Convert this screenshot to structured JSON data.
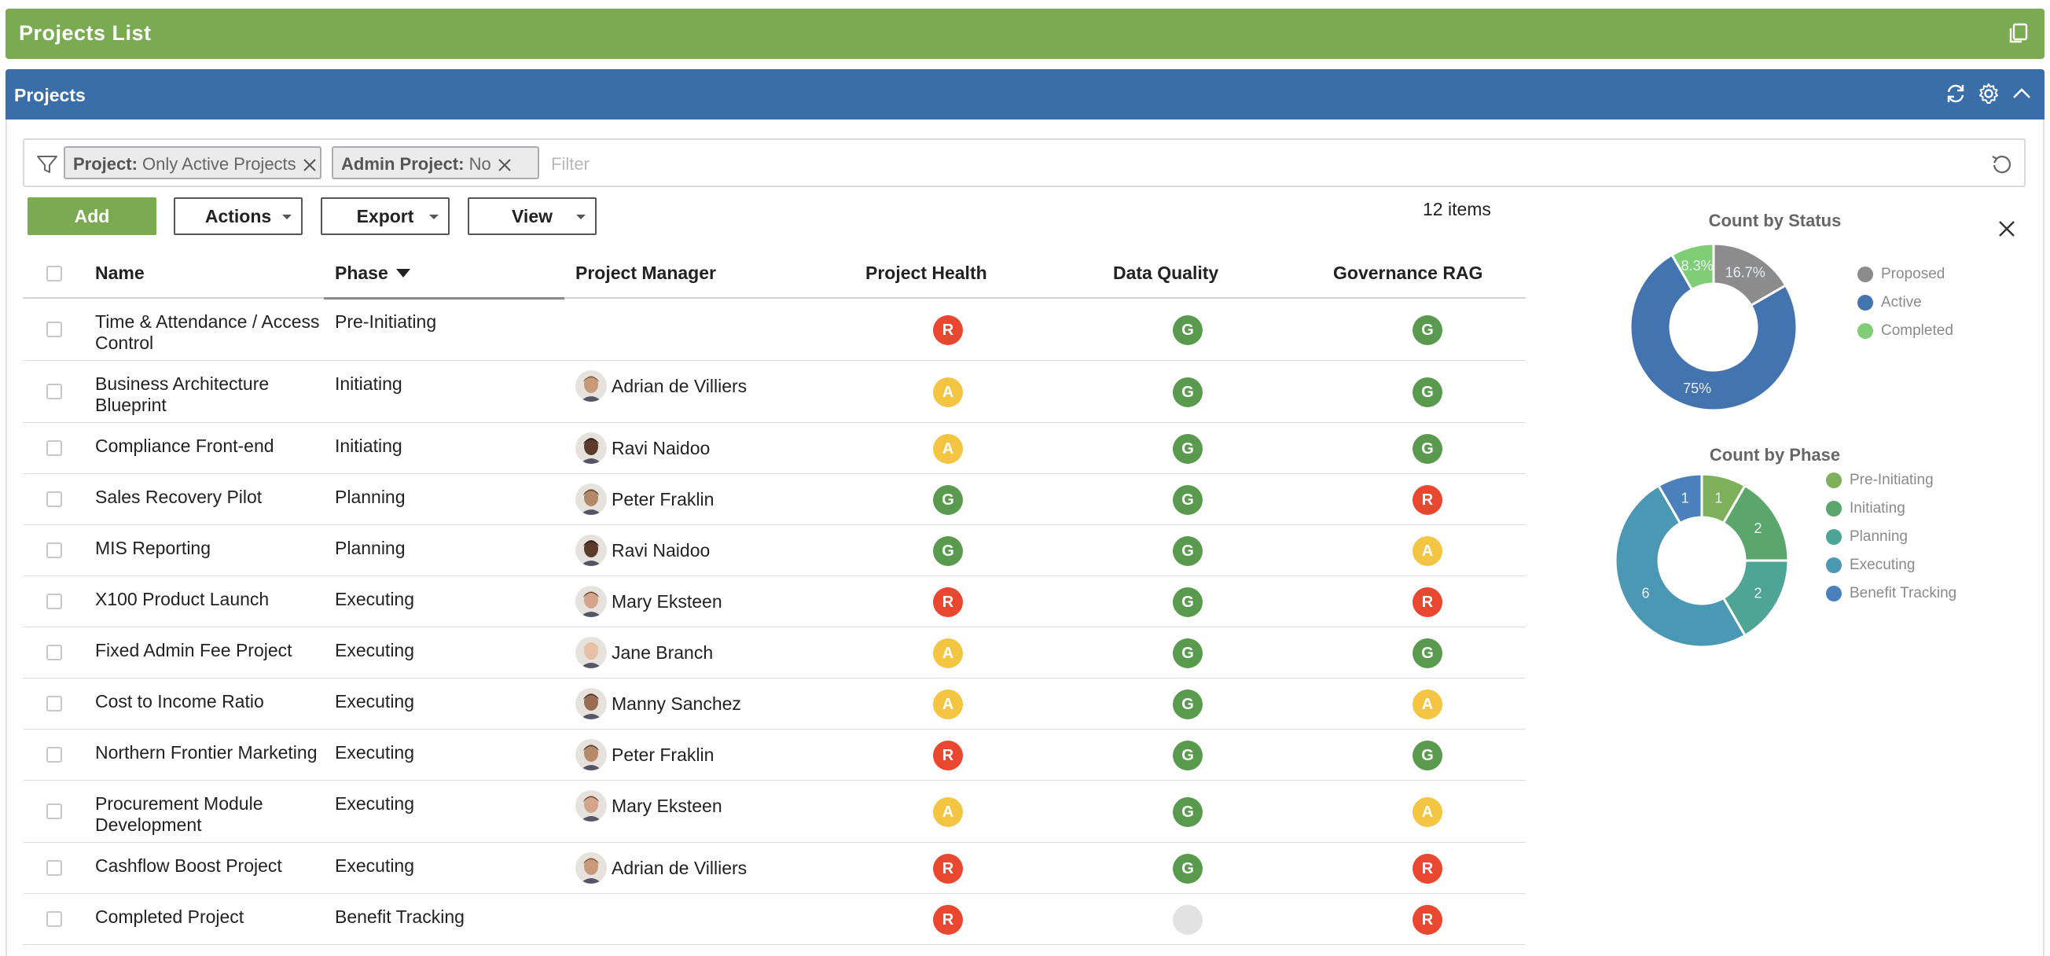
{
  "title_bar": {
    "title": "Projects List",
    "copy_icon": "copy-icon"
  },
  "panel": {
    "title": "Projects",
    "icons": [
      "refresh-icon",
      "gear-icon",
      "chevron-up-icon"
    ]
  },
  "filter": {
    "chips": [
      {
        "key": "Project:",
        "value": " Only Active Projects"
      },
      {
        "key": "Admin Project:",
        "value": " No"
      }
    ],
    "placeholder": "Filter"
  },
  "toolbar": {
    "add": "Add",
    "actions": "Actions",
    "export": "Export",
    "view": "View",
    "item_count": "12 items"
  },
  "table": {
    "columns": [
      "Name",
      "Phase",
      "Project Manager",
      "Project Health",
      "Data Quality",
      "Governance RAG"
    ],
    "rows": [
      {
        "name": "Time & Attendance / Access Control",
        "phase": "Pre-Initiating",
        "manager": "",
        "health": "R",
        "quality": "G",
        "governance": "G"
      },
      {
        "name": "Business Architecture Blueprint",
        "phase": "Initiating",
        "manager": "Adrian de Villiers",
        "health": "A",
        "quality": "G",
        "governance": "G"
      },
      {
        "name": "Compliance Front-end",
        "phase": "Initiating",
        "manager": "Ravi Naidoo",
        "health": "A",
        "quality": "G",
        "governance": "G"
      },
      {
        "name": "Sales Recovery Pilot",
        "phase": "Planning",
        "manager": "Peter Fraklin",
        "health": "G",
        "quality": "G",
        "governance": "R"
      },
      {
        "name": "MIS Reporting",
        "phase": "Planning",
        "manager": "Ravi Naidoo",
        "health": "G",
        "quality": "G",
        "governance": "A"
      },
      {
        "name": "X100 Product Launch",
        "phase": "Executing",
        "manager": "Mary Eksteen",
        "health": "R",
        "quality": "G",
        "governance": "R"
      },
      {
        "name": "Fixed Admin Fee Project",
        "phase": "Executing",
        "manager": "Jane Branch",
        "health": "A",
        "quality": "G",
        "governance": "G"
      },
      {
        "name": "Cost to Income Ratio",
        "phase": "Executing",
        "manager": "Manny Sanchez",
        "health": "A",
        "quality": "G",
        "governance": "A"
      },
      {
        "name": "Northern Frontier Marketing",
        "phase": "Executing",
        "manager": "Peter Fraklin",
        "health": "R",
        "quality": "G",
        "governance": "G"
      },
      {
        "name": "Procurement Module Development",
        "phase": "Executing",
        "manager": "Mary Eksteen",
        "health": "A",
        "quality": "G",
        "governance": "A"
      },
      {
        "name": "Cashflow Boost Project",
        "phase": "Executing",
        "manager": "Adrian de Villiers",
        "health": "R",
        "quality": "G",
        "governance": "R"
      },
      {
        "name": "Completed Project",
        "phase": "Benefit Tracking",
        "manager": "",
        "health": "R",
        "quality": "",
        "governance": "R"
      }
    ]
  },
  "rag_colors": {
    "R": "#e9472f",
    "A": "#f3c543",
    "G": "#5a9a4f",
    "": "#e2e2e2"
  },
  "chart_data": [
    {
      "type": "pie",
      "title": "Count by Status",
      "series": [
        {
          "name": "Proposed",
          "value": 2,
          "label": "16.7%",
          "color": "#8c8c8c"
        },
        {
          "name": "Active",
          "value": 9,
          "label": "75%",
          "color": "#4474b0"
        },
        {
          "name": "Completed",
          "value": 1,
          "label": "8.3%",
          "color": "#7fcd75"
        }
      ]
    },
    {
      "type": "pie",
      "title": "Count by Phase",
      "series": [
        {
          "name": "Pre-Initiating",
          "value": 1,
          "label": "1",
          "color": "#7fb15c"
        },
        {
          "name": "Initiating",
          "value": 2,
          "label": "2",
          "color": "#5ba66d"
        },
        {
          "name": "Planning",
          "value": 2,
          "label": "2",
          "color": "#4fa595"
        },
        {
          "name": "Executing",
          "value": 6,
          "label": "6",
          "color": "#4b98b5"
        },
        {
          "name": "Benefit Tracking",
          "value": 1,
          "label": "1",
          "color": "#4a80bb"
        }
      ]
    }
  ]
}
